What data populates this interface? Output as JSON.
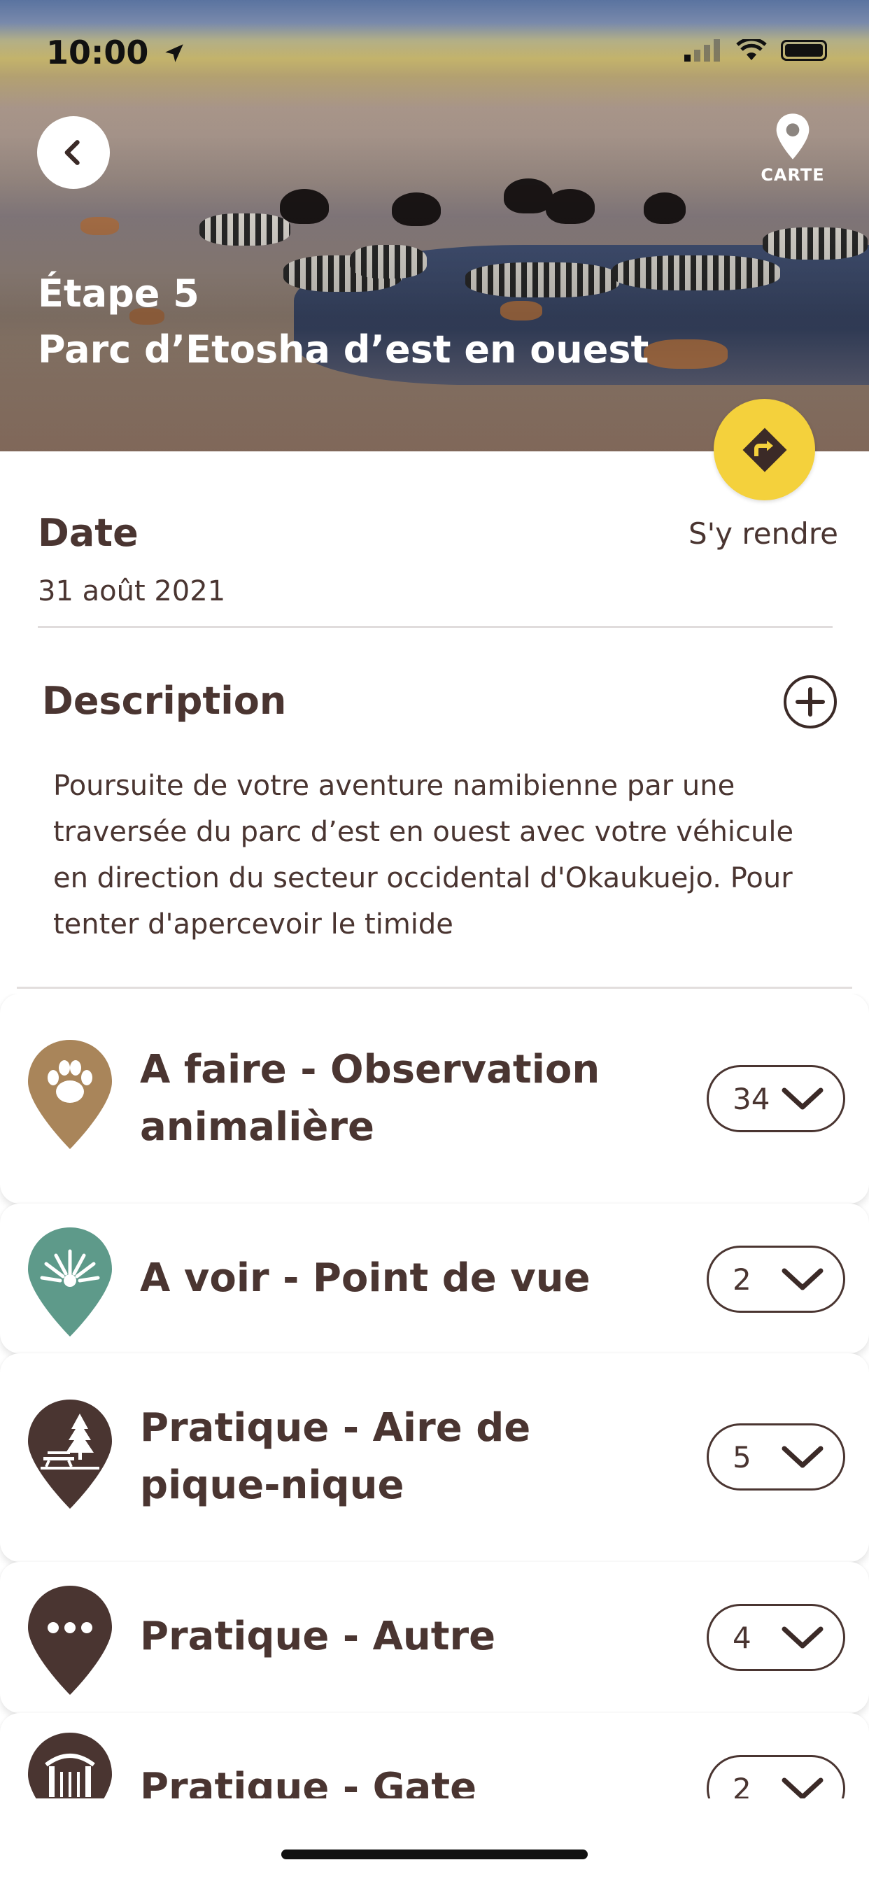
{
  "status_bar": {
    "time": "10:00"
  },
  "header": {
    "step": "Étape 5",
    "title": "Parc d’Etosha d’est en ouest",
    "map_label": "CARTE"
  },
  "date": {
    "label": "Date",
    "value": "31 août 2021",
    "go_label": "S'y rendre"
  },
  "description": {
    "label": "Description",
    "text": "Poursuite de votre aventure namibienne par une traversée du parc d’est en ouest avec votre véhicule en direction du secteur occidental d'Okaukuejo. Pour tenter d'apercevoir le timide"
  },
  "categories": [
    {
      "title": "A faire - Observation animalière",
      "count": "34",
      "icon": "paw-icon",
      "color": "#a9855a"
    },
    {
      "title": "A voir - Point de vue",
      "count": "2",
      "icon": "viewpoint-icon",
      "color": "#5e9a8a"
    },
    {
      "title": "Pratique - Aire de pique-nique",
      "count": "5",
      "icon": "picnic-icon",
      "color": "#4a3531"
    },
    {
      "title": "Pratique - Autre",
      "count": "4",
      "icon": "more-dots-icon",
      "color": "#4a3531"
    },
    {
      "title": "Pratique - Gate",
      "count": "2",
      "icon": "gate-icon",
      "color": "#4a3531"
    }
  ],
  "colors": {
    "accent_yellow": "#f4d13c",
    "text_brown": "#4a3531"
  }
}
